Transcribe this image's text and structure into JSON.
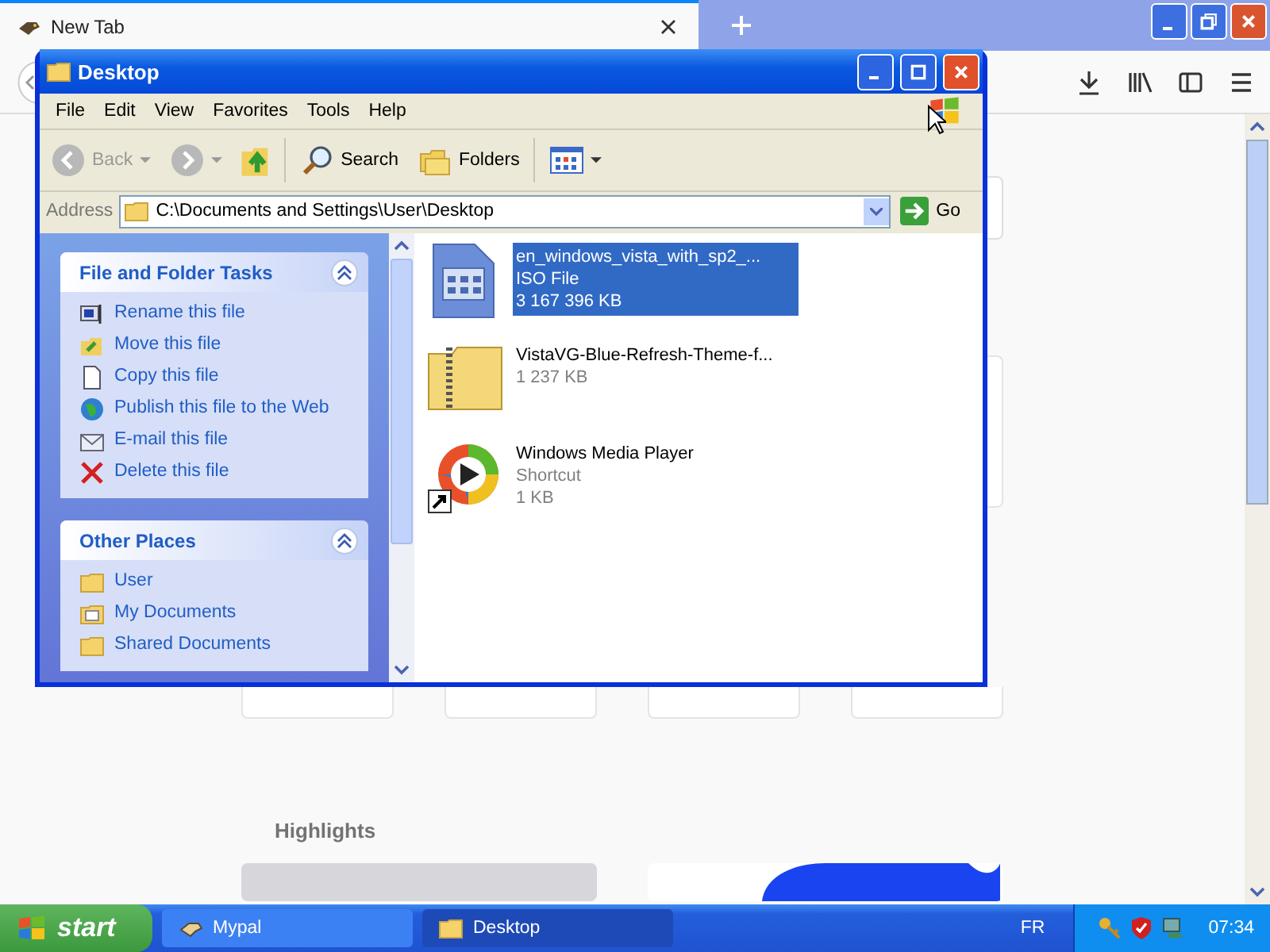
{
  "browser": {
    "tabs": [
      {
        "label": "New Tab",
        "selected": true
      }
    ],
    "page": {
      "section_heading": "Highlights"
    }
  },
  "explorer": {
    "title": "Desktop",
    "menu": [
      "File",
      "Edit",
      "View",
      "Favorites",
      "Tools",
      "Help"
    ],
    "toolbar": {
      "back": {
        "label": "Back",
        "disabled": true
      },
      "forward": {
        "disabled": true
      },
      "search": "Search",
      "folders": "Folders"
    },
    "address": {
      "label": "Address",
      "path": "C:\\Documents and Settings\\User\\Desktop",
      "go": "Go"
    },
    "panels": [
      {
        "title": "File and Folder Tasks",
        "items": [
          {
            "label": "Rename this file",
            "kind": "rename"
          },
          {
            "label": "Move this file",
            "kind": "move"
          },
          {
            "label": "Copy this file",
            "kind": "copy"
          },
          {
            "label": "Publish this file to the Web",
            "kind": "publish"
          },
          {
            "label": "E-mail this file",
            "kind": "email"
          },
          {
            "label": "Delete this file",
            "kind": "delete"
          }
        ]
      },
      {
        "title": "Other Places",
        "items": [
          {
            "label": "User",
            "kind": "folder"
          },
          {
            "label": "My Documents",
            "kind": "documents"
          },
          {
            "label": "Shared Documents",
            "kind": "folder"
          }
        ]
      }
    ],
    "files": [
      {
        "name": "en_windows_vista_with_sp2_...",
        "lines": [
          "ISO File",
          "3 167 396 KB"
        ],
        "kind": "iso",
        "selected": true
      },
      {
        "name": "VistaVG-Blue-Refresh-Theme-f...",
        "lines": [
          "1 237 KB"
        ],
        "kind": "zip",
        "selected": false
      },
      {
        "name": "Windows Media Player",
        "lines": [
          "Shortcut",
          "1 KB"
        ],
        "kind": "shortcut",
        "selected": false
      }
    ]
  },
  "taskbar": {
    "start": "start",
    "tasks": [
      {
        "label": "Mypal",
        "kind": "browser",
        "selected": false
      },
      {
        "label": "Desktop",
        "kind": "folder",
        "selected": true
      }
    ],
    "language": "FR",
    "clock": "07:34"
  }
}
